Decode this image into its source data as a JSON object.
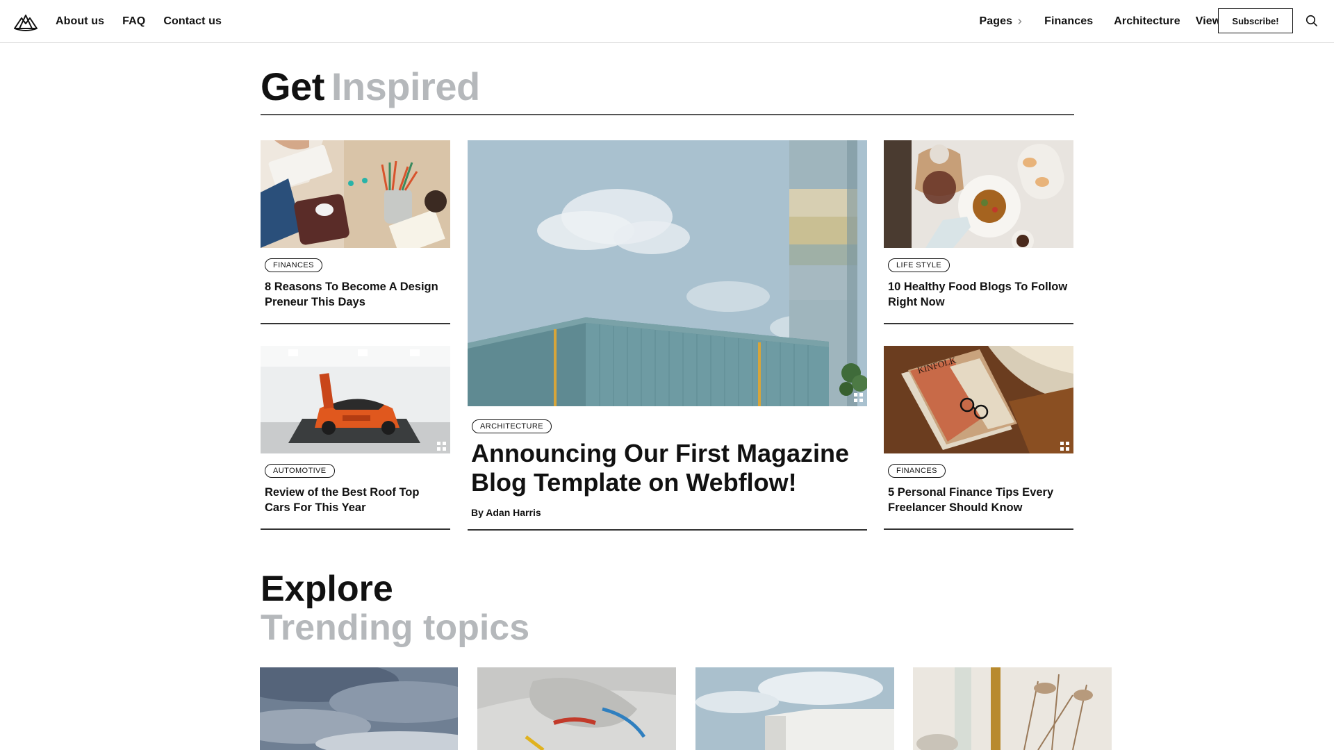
{
  "header": {
    "nav_left": [
      "About us",
      "FAQ",
      "Contact us"
    ],
    "nav_right": {
      "pages": "Pages",
      "finances": "Finances",
      "architecture": "Architecture",
      "view_all": "View All"
    },
    "subscribe_label": "Subscribe!"
  },
  "section_inspired": {
    "title_dark": "Get",
    "title_muted": "Inspired"
  },
  "cards": {
    "c1": {
      "tag": "FINANCES",
      "title": "8 Reasons To Become A Design Preneur This Days"
    },
    "c2": {
      "tag": "AUTOMOTIVE",
      "title": "Review of the Best Roof Top Cars For This Year"
    },
    "c3": {
      "tag": "LIFE STYLE",
      "title": "10 Healthy Food Blogs To Follow Right Now"
    },
    "c4": {
      "tag": "FINANCES",
      "title": "5 Personal Finance Tips Every Freelancer Should Know"
    }
  },
  "featured": {
    "tag": "ARCHITECTURE",
    "title": "Announcing Our First Magazine Blog Template on Webflow!",
    "byline": "By Adan Harris"
  },
  "section_explore": {
    "title_dark": "Explore",
    "title_muted": "Trending topics"
  },
  "colors": {
    "text": "#111111",
    "muted": "#b5b8bb",
    "rule": "#333333"
  }
}
